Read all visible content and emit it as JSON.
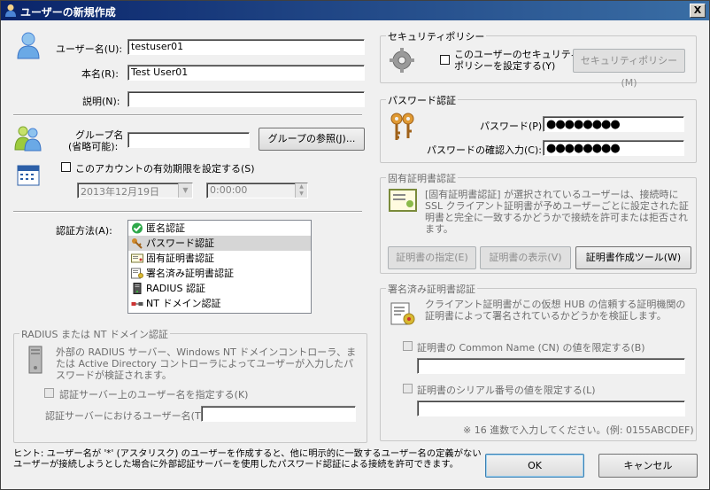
{
  "window": {
    "title": "ユーザーの新規作成",
    "close_label": "X"
  },
  "user": {
    "username_label": "ユーザー名(U):",
    "username_value": "testuser01",
    "realname_label": "本名(R):",
    "realname_value": "Test User01",
    "note_label": "説明(N):",
    "note_value": ""
  },
  "group": {
    "group_label_1": "グループ名",
    "group_label_2": "(省略可能):",
    "group_value": "",
    "browse_button": "グループの参照(J)..."
  },
  "expire": {
    "checkbox_label": "このアカウントの有効期限を設定する(S)",
    "date_value": "2013年12月19日",
    "time_value": "0:00:00"
  },
  "auth": {
    "label": "認証方法(A):",
    "items": [
      {
        "label": "匿名認証",
        "icon": "check-icon",
        "selected": false
      },
      {
        "label": "パスワード認証",
        "icon": "key-icon",
        "selected": true
      },
      {
        "label": "固有証明書認証",
        "icon": "certificate-icon",
        "selected": false
      },
      {
        "label": "署名済み証明書認証",
        "icon": "signed-cert-icon",
        "selected": false
      },
      {
        "label": "RADIUS 認証",
        "icon": "server-icon",
        "selected": false
      },
      {
        "label": "NT ドメイン認証",
        "icon": "domain-icon",
        "selected": false
      }
    ]
  },
  "radius": {
    "title": "RADIUS または NT ドメイン認証",
    "desc": "外部の RADIUS サーバー、Windows NT ドメインコントローラ、または Active Directory コントローラによってユーザーが入力したパスワードが検証されます。",
    "checkbox_label": "認証サーバー上のユーザー名を指定する(K)",
    "server_user_label": "認証サーバーにおけるユーザー名(T):",
    "server_user_value": ""
  },
  "hint": {
    "line1": "ヒント: ユーザー名が '*' (アスタリスク) のユーザーを作成すると、他に明示的に一致するユーザー名の定義がない",
    "line2": "ユーザーが接続しようとした場合に外部認証サーバーを使用したパスワード認証による接続を許可できます。"
  },
  "security": {
    "title": "セキュリティポリシー",
    "checkbox_label_1": "このユーザーのセキュリティ",
    "checkbox_label_2": "ポリシーを設定する(Y)",
    "button": "セキュリティポリシー(M)"
  },
  "password": {
    "title": "パスワード認証",
    "pw_label": "パスワード(P):",
    "pw_value": "●●●●●●●●",
    "confirm_label": "パスワードの確認入力(C):",
    "confirm_value": "●●●●●●●●"
  },
  "fixedcert": {
    "title": "固有証明書認証",
    "desc": "[固有証明書認証] が選択されているユーザーは、接続時に SSL クライアント証明書が予めユーザーごとに設定された証明書と完全に一致するかどうかで接続を許可または拒否されます。",
    "btn_specify": "証明書の指定(E)",
    "btn_view": "証明書の表示(V)",
    "btn_tool": "証明書作成ツール(W)"
  },
  "signedcert": {
    "title": "署名済み証明書認証",
    "desc": "クライアント証明書がこの仮想 HUB の信頼する証明機関の証明書によって署名されているかどうかを検証します。",
    "cn_checkbox": "証明書の Common Name (CN) の値を限定する(B)",
    "cn_value": "",
    "serial_checkbox": "証明書のシリアル番号の値を限定する(L)",
    "serial_value": "",
    "serial_hint": "※ 16 進数で入力してください。(例: 0155ABCDEF)"
  },
  "footer": {
    "ok": "OK",
    "cancel": "キャンセル"
  }
}
